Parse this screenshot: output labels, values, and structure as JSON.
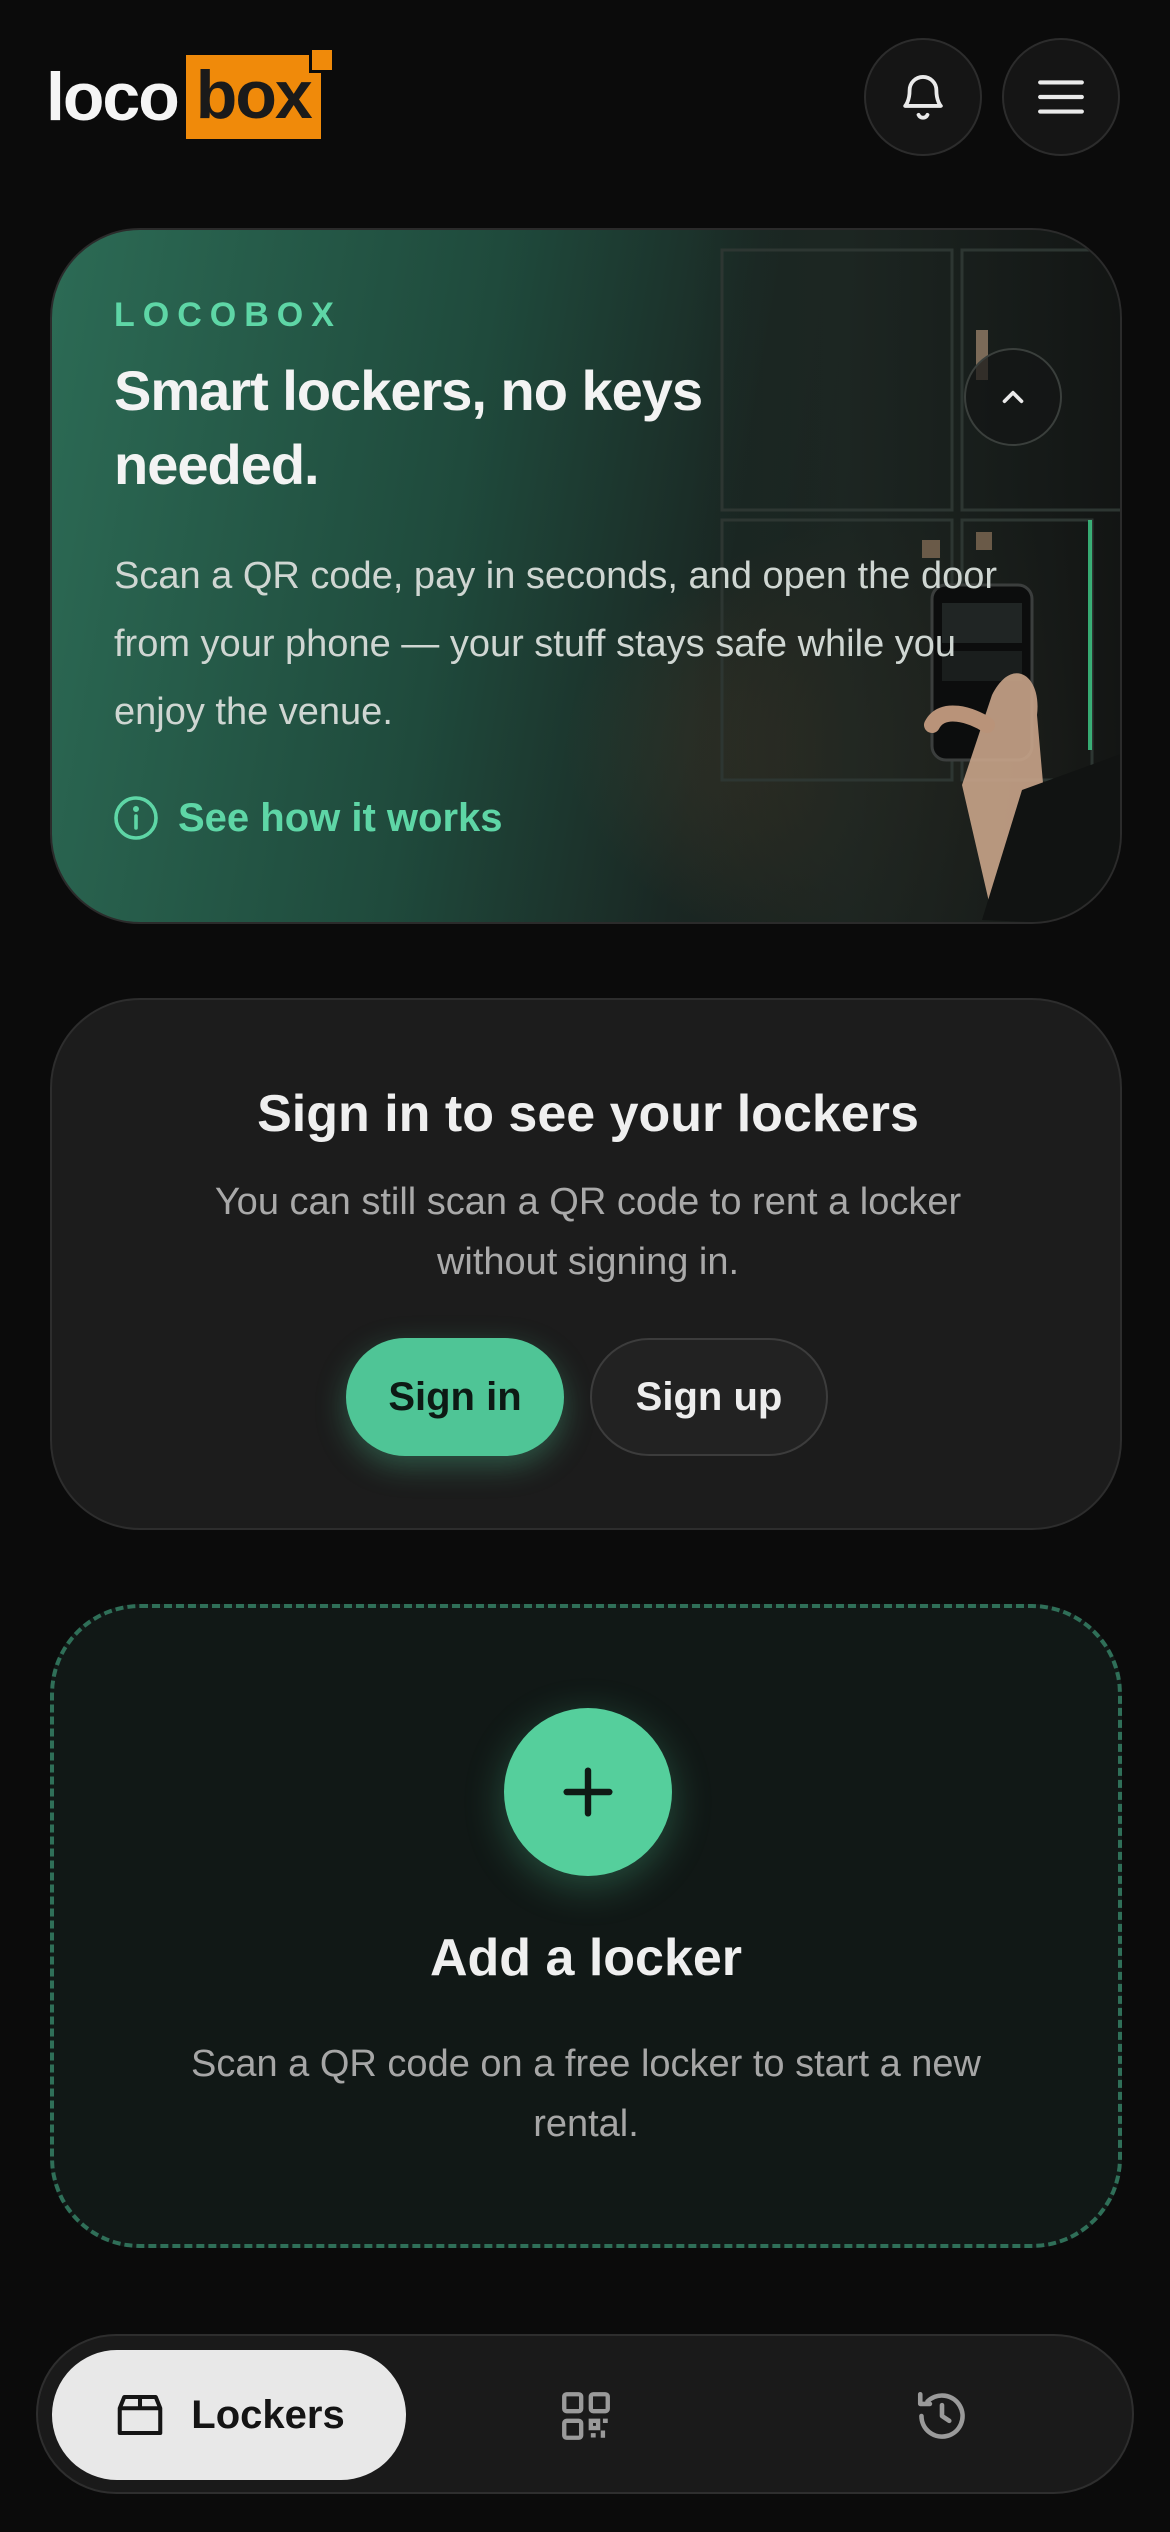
{
  "header": {
    "logo_part1": "loco",
    "logo_part2": "box",
    "notifications_icon": "bell-icon",
    "menu_icon": "hamburger-menu-icon"
  },
  "hero": {
    "eyebrow": "LOCOBOX",
    "title": "Smart lockers, no keys needed.",
    "description": "Scan a QR code, pay in seconds, and open the door from your phone — your stuff stays safe while you enjoy the venue.",
    "link_label": "See how it works",
    "link_icon": "info-circle-icon",
    "collapse_icon": "chevron-up-icon"
  },
  "signin_card": {
    "title": "Sign in to see your lockers",
    "subtitle": "You can still scan a QR code to rent a locker without signing in.",
    "signin_label": "Sign in",
    "signup_label": "Sign up"
  },
  "add_card": {
    "add_icon": "plus-icon",
    "title": "Add a locker",
    "subtitle": "Scan a QR code on a free locker to start a new rental."
  },
  "bottom_nav": {
    "items": [
      {
        "label": "Lockers",
        "icon": "box-icon",
        "active": true
      },
      {
        "label": "",
        "icon": "qr-code-icon",
        "active": false
      },
      {
        "label": "",
        "icon": "history-icon",
        "active": false
      }
    ]
  },
  "colors": {
    "accent": "#4fc596",
    "brand_orange": "#f08a0a",
    "background": "#0b0b0b",
    "card": "#1c1c1c"
  }
}
